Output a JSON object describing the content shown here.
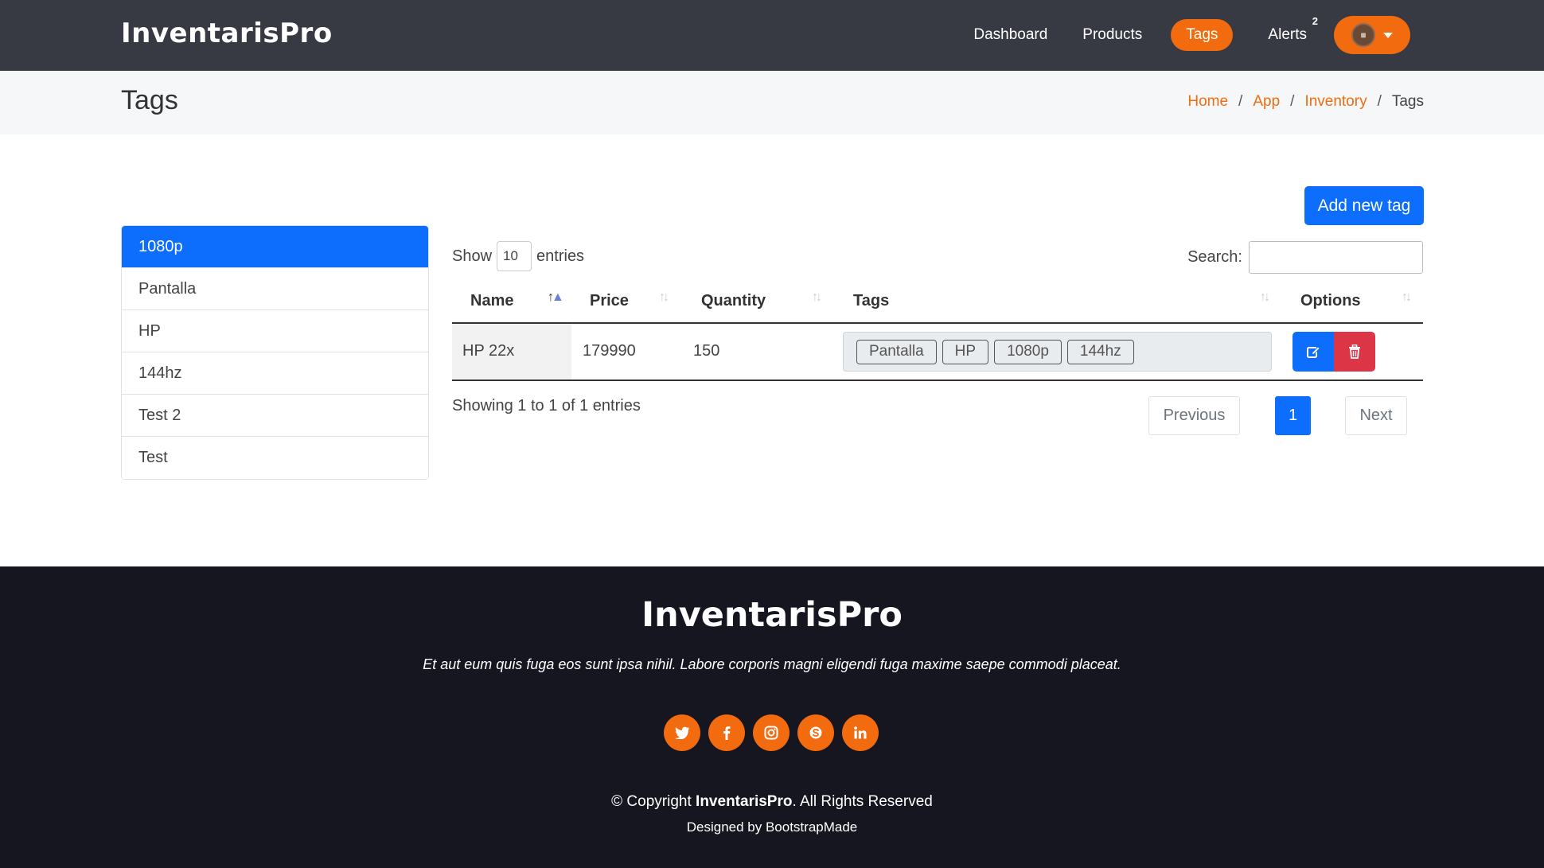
{
  "header": {
    "logo": "InventarisPro",
    "nav": [
      {
        "label": "Dashboard"
      },
      {
        "label": "Products"
      },
      {
        "label": "Tags"
      },
      {
        "label": "Alerts"
      }
    ],
    "alerts_badge": "2",
    "accent_color": "#f26b0f"
  },
  "page": {
    "title": "Tags",
    "breadcrumb": [
      "Home",
      "App",
      "Inventory",
      "Tags"
    ],
    "breadcrumb_sep": "/"
  },
  "add_button": "Add new tag",
  "tag_list": [
    "1080p",
    "Pantalla",
    "HP",
    "144hz",
    "Test 2",
    "Test"
  ],
  "table": {
    "show_label": "Show",
    "entries_value": "10",
    "entries_label": "entries",
    "search_label": "Search:",
    "columns": [
      "Name",
      "Price",
      "Quantity",
      "Tags",
      "Options"
    ],
    "rows": [
      {
        "name": "HP 22x",
        "price": "179990",
        "quantity": "150",
        "tags": [
          "Pantalla",
          "HP",
          "1080p",
          "144hz"
        ]
      }
    ],
    "info": "Showing 1 to 1 of 1 entries",
    "pagination": {
      "previous": "Previous",
      "current": "1",
      "next": "Next"
    }
  },
  "footer": {
    "logo": "InventarisPro",
    "tagline": "Et aut eum quis fuga eos sunt ipsa nihil. Labore corporis magni eligendi fuga maxime saepe commodi placeat.",
    "socials": [
      "twitter-icon",
      "facebook-icon",
      "instagram-icon",
      "skype-icon",
      "linkedin-icon"
    ],
    "copyright_prefix": "© Copyright",
    "copyright_brand": "InventarisPro",
    "copyright_suffix": ". All Rights Reserved",
    "designed_by": "Designed by BootstrapMade"
  }
}
